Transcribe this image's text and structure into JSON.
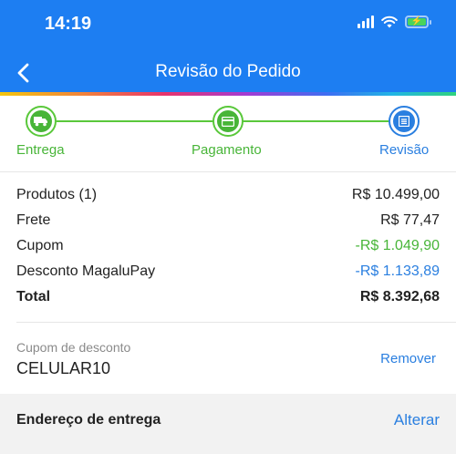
{
  "status": {
    "time": "14:19"
  },
  "nav": {
    "title": "Revisão do Pedido"
  },
  "steps": [
    {
      "label": "Entrega",
      "state": "done",
      "color": "#48b538"
    },
    {
      "label": "Pagamento",
      "state": "done",
      "color": "#48b538"
    },
    {
      "label": "Revisão",
      "state": "current",
      "color": "#2a7fe0"
    }
  ],
  "summary": {
    "products_label": "Produtos (1)",
    "products_value": "R$ 10.499,00",
    "shipping_label": "Frete",
    "shipping_value": "R$ 77,47",
    "coupon_label": "Cupom",
    "coupon_value": "-R$ 1.049,90",
    "magalupay_label": "Desconto MagaluPay",
    "magalupay_value": "-R$ 1.133,89",
    "total_label": "Total",
    "total_value": "R$ 8.392,68"
  },
  "coupon": {
    "label": "Cupom de desconto",
    "code": "CELULAR10",
    "remove_label": "Remover"
  },
  "address": {
    "title": "Endereço de entrega",
    "change_label": "Alterar"
  },
  "colors": {
    "header": "#1d7ef2",
    "success": "#48b538",
    "link": "#2a7fe0"
  }
}
